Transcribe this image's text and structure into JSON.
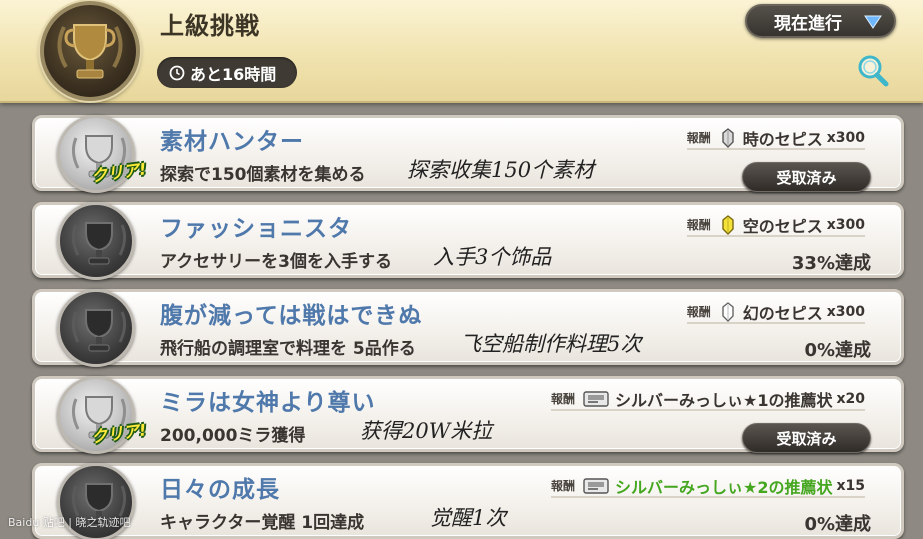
{
  "header": {
    "title": "上級挑戦",
    "timer": "あと16時間",
    "status_dropdown": "現在進行"
  },
  "quests": [
    {
      "title": "素材ハンター",
      "description": "探索で150個素材を集める",
      "note": "探索收集150个素材",
      "reward_label": "報酬",
      "reward_name": "時のセピス",
      "reward_qty": "x300",
      "cleared": true,
      "clear_badge": "クリア!",
      "action": "受取済み"
    },
    {
      "title": "ファッショニスタ",
      "description": "アクセサリーを3個を入手する",
      "note": "入手3个饰品",
      "reward_label": "報酬",
      "reward_name": "空のセピス",
      "reward_qty": "x300",
      "cleared": false,
      "progress": "33%達成",
      "progress_value": 0.33
    },
    {
      "title": "腹が減っては戦はできぬ",
      "description": "飛行船の調理室で料理を 5品作る",
      "note": "飞空船制作料理5次",
      "reward_label": "報酬",
      "reward_name": "幻のセピス",
      "reward_qty": "x300",
      "cleared": false,
      "progress": "0%達成",
      "progress_value": 0
    },
    {
      "title": "ミラは女神より尊い",
      "description": "200,000ミラ獲得",
      "note": "获得20W米拉",
      "reward_label": "報酬",
      "reward_name": "シルバーみっしぃ★1の推薦状",
      "reward_qty": "x20",
      "cleared": true,
      "clear_badge": "クリア!",
      "action": "受取済み"
    },
    {
      "title": "日々の成長",
      "description": "キャラクター覚醒 1回達成",
      "note": "觉醒1次",
      "reward_label": "報酬",
      "reward_name": "シルバーみっしぃ★2の推薦状",
      "reward_qty": "x15",
      "cleared": false,
      "progress": "0%達成",
      "progress_value": 0
    }
  ],
  "icons": {
    "quest_1_reward": "sepith-crystal-silver-icon",
    "quest_2_reward": "sepith-crystal-gold-icon",
    "quest_3_reward": "sepith-crystal-white-icon",
    "quest_4_reward": "recommendation-letter-icon",
    "quest_5_reward": "recommendation-letter-icon"
  },
  "colors": {
    "title_blue": "#4f78ab",
    "header_bg": "#f0e2ad",
    "badge_yellow": "#ffe93a",
    "highlight_green": "#45a61f",
    "dropdown_arrow": "#6fb7ff"
  },
  "watermark": "Baidu 贴吧 | 晓之轨迹吧"
}
